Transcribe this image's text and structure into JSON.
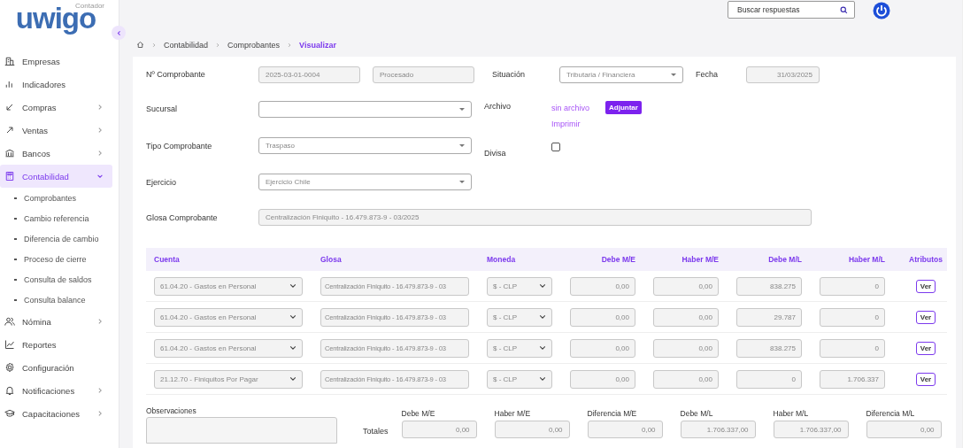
{
  "logo": {
    "name": "uwigo",
    "tagline": "Contador"
  },
  "sidebar": {
    "items": [
      {
        "label": "Empresas",
        "expandable": false,
        "selected": false
      },
      {
        "label": "Indicadores",
        "expandable": false,
        "selected": false
      },
      {
        "label": "Compras",
        "expandable": true,
        "selected": false
      },
      {
        "label": "Ventas",
        "expandable": true,
        "selected": false
      },
      {
        "label": "Bancos",
        "expandable": true,
        "selected": false
      },
      {
        "label": "Contabilidad",
        "expandable": true,
        "selected": true,
        "expanded": true,
        "children": [
          {
            "label": "Comprobantes"
          },
          {
            "label": "Cambio referencia"
          },
          {
            "label": "Diferencia de cambio"
          },
          {
            "label": "Proceso de cierre"
          },
          {
            "label": "Consulta de saldos"
          },
          {
            "label": "Consulta balance"
          }
        ]
      },
      {
        "label": "Nómina",
        "expandable": true,
        "selected": false
      },
      {
        "label": "Reportes",
        "expandable": false,
        "selected": false
      },
      {
        "label": "Configuración",
        "expandable": false,
        "selected": false
      },
      {
        "label": "Notificaciones",
        "expandable": true,
        "selected": false
      },
      {
        "label": "Capacitaciones",
        "expandable": true,
        "selected": false
      }
    ]
  },
  "search": {
    "placeholder": "Buscar respuestas"
  },
  "breadcrumb": [
    "Contabilidad",
    "Comprobantes",
    "Visualizar"
  ],
  "form": {
    "numero": {
      "label": "Nº Comprobante",
      "value": "2025-03-01-0004",
      "estado": "Procesado"
    },
    "situacion": {
      "label": "Situación",
      "value": "Tributaria / Financiera"
    },
    "fecha": {
      "label": "Fecha",
      "value": "31/03/2025"
    },
    "sucursal": {
      "label": "Sucursal"
    },
    "archivo": {
      "label": "Archivo",
      "file": "sin archivo",
      "attach": "Adjuntar",
      "print": "Imprimir"
    },
    "tipo": {
      "label": "Tipo Comprobante",
      "value": "Traspaso"
    },
    "divisa": {
      "label": "Divisa",
      "checked": false
    },
    "ejercicio": {
      "label": "Ejercicio",
      "value": "Ejercicio Chile"
    },
    "glosa": {
      "label": "Glosa Comprobante",
      "value": "Centralización Finiquito - 16.479.873-9 - 03/2025"
    }
  },
  "table": {
    "columns": [
      "Cuenta",
      "Glosa",
      "Moneda",
      "Debe M/E",
      "Haber M/E",
      "Debe M/L",
      "Haber M/L",
      "Atributos"
    ],
    "rows": [
      {
        "cuenta": "61.04.20 - Gastos en Personal",
        "glosa": "Centralización Finiquito - 16.479.873-9 - 03",
        "moneda": "$ - CLP",
        "debe_me": "0,00",
        "haber_me": "0,00",
        "debe_ml": "838.275",
        "haber_ml": "0",
        "action": "Ver"
      },
      {
        "cuenta": "61.04.20 - Gastos en Personal",
        "glosa": "Centralización Finiquito - 16.479.873-9 - 03",
        "moneda": "$ - CLP",
        "debe_me": "0,00",
        "haber_me": "0,00",
        "debe_ml": "29.787",
        "haber_ml": "0",
        "action": "Ver"
      },
      {
        "cuenta": "61.04.20 - Gastos en Personal",
        "glosa": "Centralización Finiquito - 16.479.873-9 - 03",
        "moneda": "$ - CLP",
        "debe_me": "0,00",
        "haber_me": "0,00",
        "debe_ml": "838.275",
        "haber_ml": "0",
        "action": "Ver"
      },
      {
        "cuenta": "21.12.70 - Finiquitos Por Pagar",
        "glosa": "Centralización Finiquito - 16.479.873-9 - 03",
        "moneda": "$ - CLP",
        "debe_me": "0,00",
        "haber_me": "0,00",
        "debe_ml": "0",
        "haber_ml": "1.706.337",
        "action": "Ver"
      }
    ]
  },
  "observaciones": {
    "label": "Observaciones"
  },
  "totals": {
    "label": "Totales",
    "items": [
      {
        "label": "Debe M/E",
        "value": "0,00"
      },
      {
        "label": "Haber M/E",
        "value": "0,00"
      },
      {
        "label": "Diferencia M/E",
        "value": "0,00"
      },
      {
        "label": "Debe M/L",
        "value": "1.706.337,00"
      },
      {
        "label": "Haber M/L",
        "value": "1.706.337,00"
      },
      {
        "label": "Diferencia M/L",
        "value": "0,00"
      }
    ]
  }
}
